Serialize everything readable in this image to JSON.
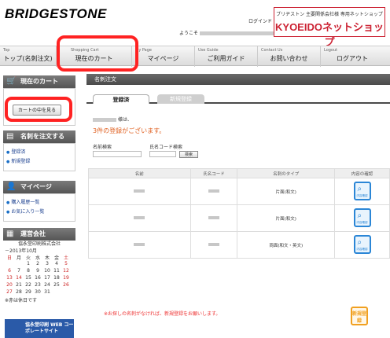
{
  "header": {
    "logo": "BRIDGESTONE",
    "login_label": "ログインド",
    "welcome_prefix": "ようこそ",
    "shop_subtitle": "ブリヂストン 主要関係会社様 専用ネットショップ",
    "shop_title": "KYOEIDOネットショップ"
  },
  "nav": [
    {
      "en": "Top",
      "jp": "トップ(名刺注文)"
    },
    {
      "en": "Shopping Cart",
      "jp": "現在のカート"
    },
    {
      "en": "My Page",
      "jp": "マイページ"
    },
    {
      "en": "Use Guide",
      "jp": "ご利用ガイド"
    },
    {
      "en": "Contact Us",
      "jp": "お問い合わせ"
    },
    {
      "en": "Logout",
      "jp": "ログアウト"
    }
  ],
  "sidebar": {
    "cart_heading": "現在のカート",
    "cart_button": "カートの中を見る",
    "order_heading": "名刺を注文する",
    "order_links": [
      "登録済",
      "新規登録"
    ],
    "mypage_heading": "マイページ",
    "mypage_links": [
      "購入履歴一覧",
      "お気に入り一覧"
    ],
    "company_heading": "運営会社",
    "company_name": "協永堂印刷株式会社",
    "calendar_month": "－2013年10月",
    "weekdays": [
      "日",
      "月",
      "火",
      "水",
      "木",
      "金",
      "土"
    ],
    "weeks": [
      [
        "",
        "",
        "1",
        "2",
        "3",
        "4",
        "5"
      ],
      [
        "6",
        "7",
        "8",
        "9",
        "10",
        "11",
        "12"
      ],
      [
        "13",
        "14",
        "15",
        "16",
        "17",
        "18",
        "19"
      ],
      [
        "20",
        "21",
        "22",
        "23",
        "24",
        "25",
        "26"
      ],
      [
        "27",
        "28",
        "29",
        "30",
        "31",
        "",
        ""
      ]
    ],
    "calendar_note": "※赤は休日です",
    "web_button": "協永堂印刷 WEB コーポレートサイト"
  },
  "main": {
    "heading": "名刺注文",
    "tabs": [
      "登録済",
      "新規登録"
    ],
    "greeting_suffix": "様は、",
    "count_text": "3件の登録がございます。",
    "search_name_label": "名前検索",
    "search_code_label": "氏名コード検索",
    "search_button": "検索",
    "columns": [
      "名前",
      "氏名コード",
      "名刺のタイプ",
      "内容の確認"
    ],
    "rows": [
      {
        "type": "片面(和文)",
        "confirm": "内容確認"
      },
      {
        "type": "片面(和文)",
        "confirm": "内容確認"
      },
      {
        "type": "両面(和文・英文)",
        "confirm": "内容確認"
      }
    ],
    "notice": "※お探しの名刺がなければ、新規登録をお願いします。",
    "new_button": "新規登録"
  }
}
